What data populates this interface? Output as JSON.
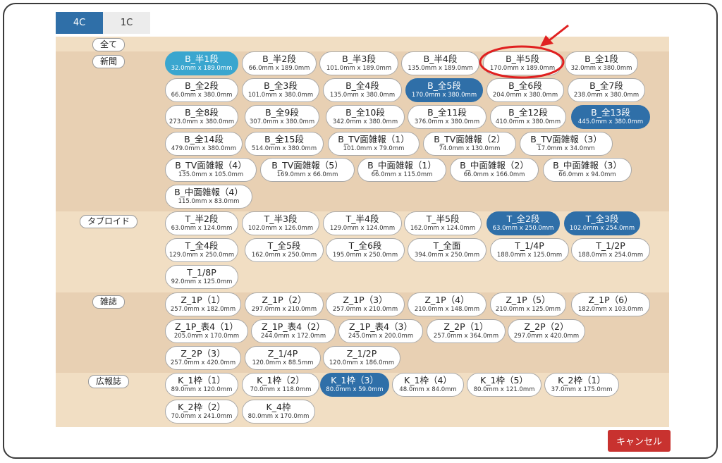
{
  "tabs": [
    {
      "label": "4C",
      "active": true
    },
    {
      "label": "1C",
      "active": false
    }
  ],
  "sections": {
    "all": {
      "label": "全て"
    },
    "newspaper": {
      "label": "新聞",
      "items": [
        {
          "name": "B_半1段",
          "size": "32.0mm x 189.0mm",
          "state": "light"
        },
        {
          "name": "B_半2段",
          "size": "66.0mm x 189.0mm",
          "state": ""
        },
        {
          "name": "B_半3段",
          "size": "101.0mm x 189.0mm",
          "state": ""
        },
        {
          "name": "B_半4段",
          "size": "135.0mm x 189.0mm",
          "state": ""
        },
        {
          "name": "B_半5段",
          "size": "170.0mm x 189.0mm",
          "state": ""
        },
        {
          "name": "B_全1段",
          "size": "32.0mm x 380.0mm",
          "state": ""
        },
        {
          "name": "B_全2段",
          "size": "66.0mm x 380.0mm",
          "state": ""
        },
        {
          "name": "B_全3段",
          "size": "101.0mm x 380.0mm",
          "state": ""
        },
        {
          "name": "B_全4段",
          "size": "135.0mm x 380.0mm",
          "state": ""
        },
        {
          "name": "B_全5段",
          "size": "170.0mm x 380.0mm",
          "state": "dark"
        },
        {
          "name": "B_全6段",
          "size": "204.0mm x 380.0mm",
          "state": ""
        },
        {
          "name": "B_全7段",
          "size": "238.0mm x 380.0mm",
          "state": ""
        },
        {
          "name": "B_全8段",
          "size": "273.0mm x 380.0mm",
          "state": ""
        },
        {
          "name": "B_全9段",
          "size": "307.0mm x 380.0mm",
          "state": ""
        },
        {
          "name": "B_全10段",
          "size": "342.0mm x 380.0mm",
          "state": ""
        },
        {
          "name": "B_全11段",
          "size": "376.0mm x 380.0mm",
          "state": ""
        },
        {
          "name": "B_全12段",
          "size": "410.0mm x 380.0mm",
          "state": ""
        },
        {
          "name": "B_全13段",
          "size": "445.0mm x 380.0mm",
          "state": "dark"
        },
        {
          "name": "B_全14段",
          "size": "479.0mm x 380.0mm",
          "state": ""
        },
        {
          "name": "B_全15段",
          "size": "514.0mm x 380.0mm",
          "state": ""
        },
        {
          "name": "B_TV面雑報（1）",
          "size": "101.0mm x 79.0mm",
          "state": ""
        },
        {
          "name": "B_TV面雑報（2）",
          "size": "74.0mm x 130.0mm",
          "state": ""
        },
        {
          "name": "B_TV面雑報（3）",
          "size": "17.0mm x 34.0mm",
          "state": ""
        },
        {
          "name": "B_TV面雑報（4）",
          "size": "135.0mm x 105.0mm",
          "state": ""
        },
        {
          "name": "B_TV面雑報（5）",
          "size": "169.0mm x 66.0mm",
          "state": ""
        },
        {
          "name": "B_中面雑報（1）",
          "size": "66.0mm x 115.0mm",
          "state": ""
        },
        {
          "name": "B_中面雑報（2）",
          "size": "66.0mm x 166.0mm",
          "state": ""
        },
        {
          "name": "B_中面雑報（3）",
          "size": "66.0mm x 94.0mm",
          "state": ""
        },
        {
          "name": "B_中面雑報（4）",
          "size": "115.0mm x 83.0mm",
          "state": ""
        }
      ]
    },
    "tabloid": {
      "label": "タブロイド",
      "items": [
        {
          "name": "T_半2段",
          "size": "63.0mm x 124.0mm",
          "state": ""
        },
        {
          "name": "T_半3段",
          "size": "102.0mm x 126.0mm",
          "state": ""
        },
        {
          "name": "T_半4段",
          "size": "129.0mm x 124.0mm",
          "state": ""
        },
        {
          "name": "T_半5段",
          "size": "162.0mm x 124.0mm",
          "state": ""
        },
        {
          "name": "T_全2段",
          "size": "63.0mm x 250.0mm",
          "state": "dark"
        },
        {
          "name": "T_全3段",
          "size": "102.0mm x 254.0mm",
          "state": "dark"
        },
        {
          "name": "T_全4段",
          "size": "129.0mm x 250.0mm",
          "state": ""
        },
        {
          "name": "T_全5段",
          "size": "162.0mm x 250.0mm",
          "state": ""
        },
        {
          "name": "T_全6段",
          "size": "195.0mm x 250.0mm",
          "state": ""
        },
        {
          "name": "T_全面",
          "size": "394.0mm x 250.0mm",
          "state": ""
        },
        {
          "name": "T_1/4P",
          "size": "188.0mm x 125.0mm",
          "state": ""
        },
        {
          "name": "T_1/2P",
          "size": "188.0mm x 254.0mm",
          "state": ""
        },
        {
          "name": "T_1/8P",
          "size": "92.0mm x 125.0mm",
          "state": ""
        }
      ]
    },
    "magazine": {
      "label": "雑誌",
      "items": [
        {
          "name": "Z_1P（1）",
          "size": "257.0mm x 182.0mm",
          "state": ""
        },
        {
          "name": "Z_1P（2）",
          "size": "297.0mm x 210.0mm",
          "state": ""
        },
        {
          "name": "Z_1P（3）",
          "size": "257.0mm x 210.0mm",
          "state": ""
        },
        {
          "name": "Z_1P（4）",
          "size": "210.0mm x 148.0mm",
          "state": ""
        },
        {
          "name": "Z_1P（5）",
          "size": "210.0mm x 125.0mm",
          "state": ""
        },
        {
          "name": "Z_1P（6）",
          "size": "182.0mm x 103.0mm",
          "state": ""
        },
        {
          "name": "Z_1P_表4（1）",
          "size": "205.0mm x 170.0mm",
          "state": ""
        },
        {
          "name": "Z_1P_表4（2）",
          "size": "244.0mm x 172.0mm",
          "state": ""
        },
        {
          "name": "Z_1P_表4（3）",
          "size": "245.0mm x 200.0mm",
          "state": ""
        },
        {
          "name": "Z_2P（1）",
          "size": "257.0mm x 364.0mm",
          "state": ""
        },
        {
          "name": "Z_2P（2）",
          "size": "297.0mm x 420.0mm",
          "state": ""
        },
        {
          "name": "Z_2P（3）",
          "size": "257.0mm x 420.0mm",
          "state": ""
        },
        {
          "name": "Z_1/4P",
          "size": "120.0mm x 88.5mm",
          "state": ""
        },
        {
          "name": "Z_1/2P",
          "size": "120.0mm x 186.0mm",
          "state": ""
        }
      ]
    },
    "pr": {
      "label": "広報誌",
      "items": [
        {
          "name": "K_1枠（1）",
          "size": "89.0mm x 120.0mm",
          "state": ""
        },
        {
          "name": "K_1枠（2）",
          "size": "70.0mm x 118.0mm",
          "state": ""
        },
        {
          "name": "K_1枠（3）",
          "size": "80.0mm x 59.0mm",
          "state": "dark"
        },
        {
          "name": "K_1枠（4）",
          "size": "48.0mm x 84.0mm",
          "state": ""
        },
        {
          "name": "K_1枠（5）",
          "size": "80.0mm x 121.0mm",
          "state": ""
        },
        {
          "name": "K_2枠（1）",
          "size": "37.0mm x 175.0mm",
          "state": ""
        },
        {
          "name": "K_2枠（2）",
          "size": "70.0mm x 241.0mm",
          "state": ""
        },
        {
          "name": "K_4枠",
          "size": "80.0mm x 170.0mm",
          "state": ""
        }
      ]
    }
  },
  "cancel_label": "キャンセル",
  "colors": {
    "accent": "#2f6fa8",
    "accent_light": "#3aa6cf",
    "panel": "#f1dec3",
    "panel_alt": "#e8d0b3",
    "cancel": "#c8322f",
    "annotation": "#e02020"
  }
}
